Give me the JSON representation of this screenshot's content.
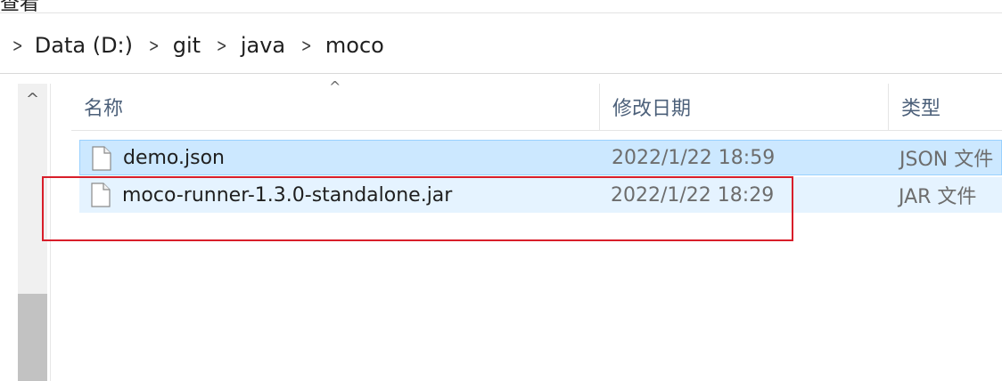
{
  "top": {
    "cut_text": "查看"
  },
  "breadcrumb": {
    "items": [
      "Data (D:)",
      "git",
      "java",
      "moco"
    ]
  },
  "nav_scroll": {
    "up_arrow": "^"
  },
  "columns": {
    "name": "名称",
    "date": "修改日期",
    "type": "类型",
    "sort_caret": "^"
  },
  "files": [
    {
      "name": "demo.json",
      "modified": "2022/1/22 18:59",
      "type": "JSON 文件",
      "state": "selected",
      "icon": "generic-file-icon"
    },
    {
      "name": "moco-runner-1.3.0-standalone.jar",
      "modified": "2022/1/22 18:29",
      "type": "JAR 文件",
      "state": "hover",
      "icon": "generic-file-icon"
    }
  ],
  "colors": {
    "selection_bg": "#cce8ff",
    "selection_border": "#99d1ff",
    "hover_bg": "#e5f3ff",
    "annotation": "#d81e2a",
    "header_text": "#4c607a"
  }
}
